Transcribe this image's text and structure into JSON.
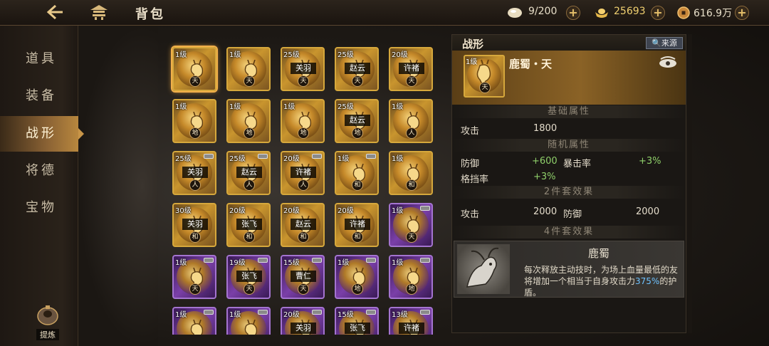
{
  "topbar": {
    "title": "背包",
    "resources": [
      {
        "name": "egg-icon",
        "value": "9/200"
      },
      {
        "name": "gold-ingot-icon",
        "value": "25693"
      },
      {
        "name": "coin-icon",
        "value": "616.9万"
      }
    ]
  },
  "sidebar": {
    "items": [
      {
        "label": "道具"
      },
      {
        "label": "装备"
      },
      {
        "label": "战形"
      },
      {
        "label": "将德"
      },
      {
        "label": "宝物"
      }
    ],
    "active_index": 2,
    "refine_label": "提炼"
  },
  "grid": {
    "cards": [
      {
        "level": "1级",
        "name": "",
        "elem": "天",
        "rarity": "gold",
        "selected": true,
        "tag": false
      },
      {
        "level": "1级",
        "name": "",
        "elem": "天",
        "rarity": "gold",
        "selected": false,
        "tag": false
      },
      {
        "level": "25级",
        "name": "关羽",
        "elem": "天",
        "rarity": "gold",
        "selected": false,
        "tag": false
      },
      {
        "level": "25级",
        "name": "赵云",
        "elem": "天",
        "rarity": "gold",
        "selected": false,
        "tag": false
      },
      {
        "level": "20级",
        "name": "许褚",
        "elem": "天",
        "rarity": "gold",
        "selected": false,
        "tag": false
      },
      {
        "level": "1级",
        "name": "",
        "elem": "地",
        "rarity": "gold",
        "selected": false,
        "tag": false
      },
      {
        "level": "1级",
        "name": "",
        "elem": "地",
        "rarity": "gold",
        "selected": false,
        "tag": false
      },
      {
        "level": "1级",
        "name": "",
        "elem": "地",
        "rarity": "gold",
        "selected": false,
        "tag": false
      },
      {
        "level": "25级",
        "name": "赵云",
        "elem": "地",
        "rarity": "gold",
        "selected": false,
        "tag": false
      },
      {
        "level": "1级",
        "name": "",
        "elem": "人",
        "rarity": "gold",
        "selected": false,
        "tag": false
      },
      {
        "level": "25级",
        "name": "关羽",
        "elem": "人",
        "rarity": "gold",
        "selected": false,
        "tag": true
      },
      {
        "level": "25级",
        "name": "赵云",
        "elem": "人",
        "rarity": "gold",
        "selected": false,
        "tag": true
      },
      {
        "level": "20级",
        "name": "许褚",
        "elem": "人",
        "rarity": "gold",
        "selected": false,
        "tag": true
      },
      {
        "level": "1级",
        "name": "",
        "elem": "和",
        "rarity": "gold",
        "selected": false,
        "tag": true
      },
      {
        "level": "1级",
        "name": "",
        "elem": "和",
        "rarity": "gold",
        "selected": false,
        "tag": false
      },
      {
        "level": "30级",
        "name": "关羽",
        "elem": "和",
        "rarity": "gold",
        "selected": false,
        "tag": false
      },
      {
        "level": "20级",
        "name": "张飞",
        "elem": "和",
        "rarity": "gold",
        "selected": false,
        "tag": false
      },
      {
        "level": "20级",
        "name": "赵云",
        "elem": "和",
        "rarity": "gold",
        "selected": false,
        "tag": false
      },
      {
        "level": "20级",
        "name": "许褚",
        "elem": "和",
        "rarity": "gold",
        "selected": false,
        "tag": false
      },
      {
        "level": "1级",
        "name": "",
        "elem": "天",
        "rarity": "purple",
        "selected": false,
        "tag": true
      },
      {
        "level": "1级",
        "name": "",
        "elem": "天",
        "rarity": "purple",
        "selected": false,
        "tag": true
      },
      {
        "level": "19级",
        "name": "张飞",
        "elem": "天",
        "rarity": "purple",
        "selected": false,
        "tag": true
      },
      {
        "level": "15级",
        "name": "曹仁",
        "elem": "天",
        "rarity": "purple",
        "selected": false,
        "tag": true
      },
      {
        "level": "1级",
        "name": "",
        "elem": "地",
        "rarity": "purple",
        "selected": false,
        "tag": true
      },
      {
        "level": "1级",
        "name": "",
        "elem": "地",
        "rarity": "purple",
        "selected": false,
        "tag": true
      },
      {
        "level": "1级",
        "name": "",
        "elem": "",
        "rarity": "purple",
        "selected": false,
        "tag": true
      },
      {
        "level": "1级",
        "name": "",
        "elem": "",
        "rarity": "purple",
        "selected": false,
        "tag": true
      },
      {
        "level": "20级",
        "name": "关羽",
        "elem": "",
        "rarity": "purple",
        "selected": false,
        "tag": true
      },
      {
        "level": "15级",
        "name": "张飞",
        "elem": "",
        "rarity": "purple",
        "selected": false,
        "tag": true
      },
      {
        "level": "13级",
        "name": "许褚",
        "elem": "",
        "rarity": "purple",
        "selected": false,
        "tag": true
      }
    ]
  },
  "panel": {
    "title": "战形",
    "source_label": "来源",
    "hero": {
      "level": "1级",
      "elem": "天",
      "name": "鹿蜀・天"
    },
    "base_header": "基础属性",
    "base": [
      {
        "label": "攻击",
        "value": "1800"
      }
    ],
    "random_header": "随机属性",
    "random": [
      {
        "label": "防御",
        "value": "+600"
      },
      {
        "label": "暴击率",
        "value": "+3%"
      },
      {
        "label": "格挡率",
        "value": "+3%"
      }
    ],
    "set2_header": "2件套效果",
    "set2": [
      {
        "label": "攻击",
        "value": "2000"
      },
      {
        "label": "防御",
        "value": "2000"
      }
    ],
    "set4_header": "4件套效果",
    "set4": {
      "name": "鹿蜀",
      "desc_pre": "每次释放主动技时，为场上血量最低的友将增加一个相当于自身攻击力",
      "desc_hl": "375%",
      "desc_post": "的护盾。"
    }
  }
}
